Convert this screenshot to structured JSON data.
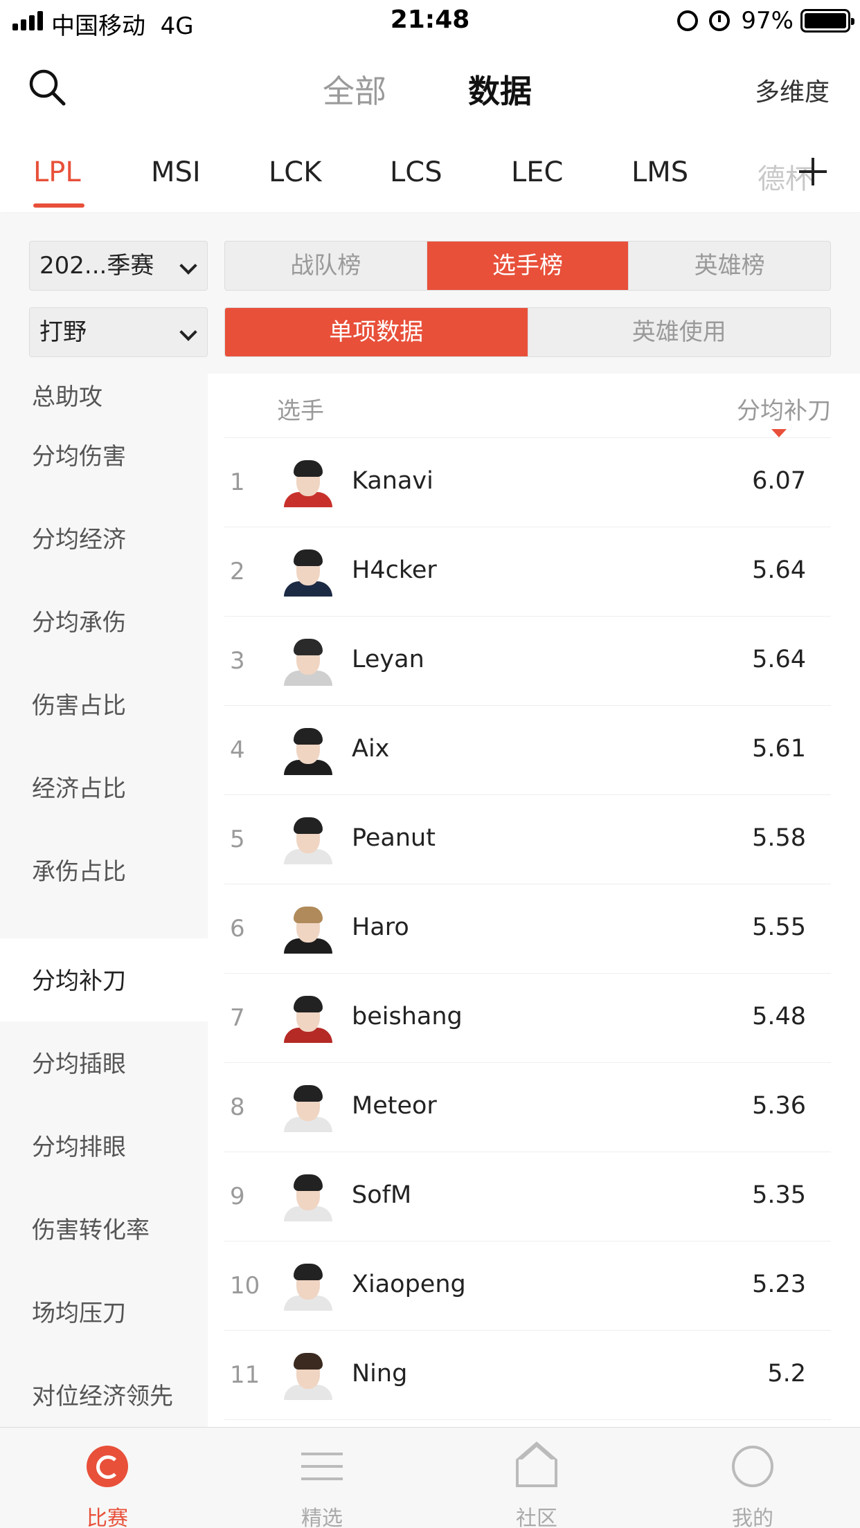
{
  "status_bar": {
    "carrier": "中国移动",
    "network": "4G",
    "time": "21:48",
    "battery": "97%",
    "icons": [
      "signal-icon",
      "rotation-lock-icon",
      "alarm-icon",
      "battery-icon"
    ]
  },
  "header": {
    "search_icon": "search-icon",
    "tabs": [
      {
        "label": "全部",
        "active": false
      },
      {
        "label": "数据",
        "active": true
      }
    ],
    "right_link": "多维度"
  },
  "leagues": {
    "items": [
      {
        "label": "LPL",
        "active": true
      },
      {
        "label": "MSI",
        "active": false
      },
      {
        "label": "LCK",
        "active": false
      },
      {
        "label": "LCS",
        "active": false
      },
      {
        "label": "LEC",
        "active": false
      },
      {
        "label": "LMS",
        "active": false
      },
      {
        "label": "德杯",
        "active": false
      }
    ],
    "add_icon": "plus-icon",
    "active_color": "#e8503a"
  },
  "filters": {
    "season": "202...季赛",
    "role": "打野",
    "ranking_tabs": [
      {
        "label": "战队榜",
        "active": false
      },
      {
        "label": "选手榜",
        "active": true
      },
      {
        "label": "英雄榜",
        "active": false
      }
    ],
    "data_tabs": [
      {
        "label": "单项数据",
        "active": true
      },
      {
        "label": "英雄使用",
        "active": false
      }
    ]
  },
  "stat_menu": {
    "items": [
      {
        "label": "总助攻",
        "active": false
      },
      {
        "label": "分均伤害",
        "active": false
      },
      {
        "label": "分均经济",
        "active": false
      },
      {
        "label": "分均承伤",
        "active": false
      },
      {
        "label": "伤害占比",
        "active": false
      },
      {
        "label": "经济占比",
        "active": false
      },
      {
        "label": "承伤占比",
        "active": false
      },
      {
        "label": "分均补刀",
        "active": true
      },
      {
        "label": "分均插眼",
        "active": false
      },
      {
        "label": "分均排眼",
        "active": false
      },
      {
        "label": "伤害转化率",
        "active": false
      },
      {
        "label": "场均压刀",
        "active": false
      },
      {
        "label": "对位经济领先",
        "active": false
      }
    ]
  },
  "table": {
    "col_player": "选手",
    "col_stat": "分均补刀",
    "sort_icon": "sort-desc-icon",
    "rows": [
      {
        "rank": "1",
        "name": "Kanavi",
        "value": "6.07"
      },
      {
        "rank": "2",
        "name": "H4cker",
        "value": "5.64"
      },
      {
        "rank": "3",
        "name": "Leyan",
        "value": "5.64"
      },
      {
        "rank": "4",
        "name": "Aix",
        "value": "5.61"
      },
      {
        "rank": "5",
        "name": "Peanut",
        "value": "5.58"
      },
      {
        "rank": "6",
        "name": "Haro",
        "value": "5.55"
      },
      {
        "rank": "7",
        "name": "beishang",
        "value": "5.48"
      },
      {
        "rank": "8",
        "name": "Meteor",
        "value": "5.36"
      },
      {
        "rank": "9",
        "name": "SofM",
        "value": "5.35"
      },
      {
        "rank": "10",
        "name": "Xiaopeng",
        "value": "5.23"
      },
      {
        "rank": "11",
        "name": "Ning",
        "value": "5.2"
      }
    ]
  },
  "tabbar": {
    "items": [
      {
        "label": "比赛",
        "icon": "match-icon",
        "active": true
      },
      {
        "label": "精选",
        "icon": "list-icon",
        "active": false
      },
      {
        "label": "社区",
        "icon": "community-icon",
        "active": false
      },
      {
        "label": "我的",
        "icon": "profile-icon",
        "active": false
      }
    ]
  }
}
